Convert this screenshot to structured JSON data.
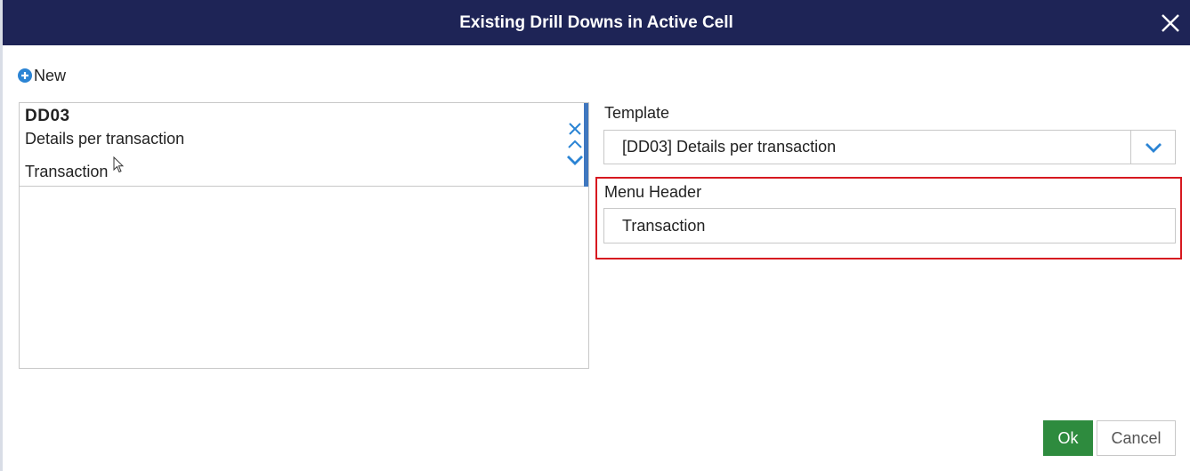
{
  "dialog": {
    "title": "Existing Drill Downs in Active Cell",
    "new_label": "New"
  },
  "list": {
    "items": [
      {
        "code": "DD03",
        "description": "Details per transaction",
        "menu_header": "Transaction"
      }
    ]
  },
  "form": {
    "template_label": "Template",
    "template_value": "[DD03] Details per transaction",
    "menu_header_label": "Menu Header",
    "menu_header_value": "Transaction"
  },
  "buttons": {
    "ok": "Ok",
    "cancel": "Cancel"
  },
  "colors": {
    "titlebar": "#1e2456",
    "accent_blue": "#2b84d4",
    "ok_green": "#2e8b3e",
    "highlight_red": "#d71920"
  }
}
